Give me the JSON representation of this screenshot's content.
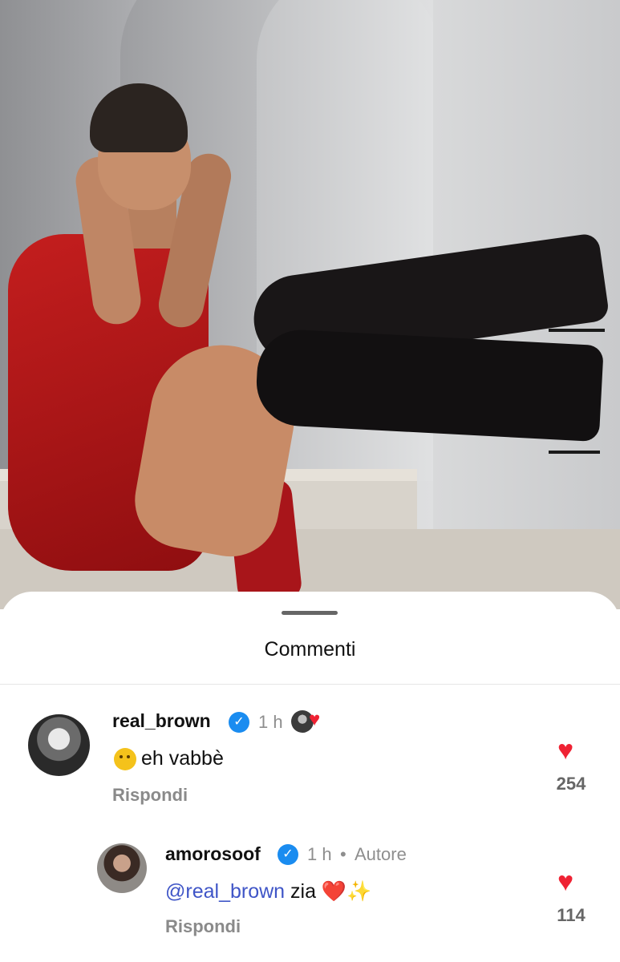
{
  "sheet": {
    "title": "Commenti"
  },
  "comments": [
    {
      "username": "real_brown",
      "verified": true,
      "time": "1 h",
      "liked_by_author": true,
      "emoji": "melting-face-emoji",
      "text": "eh vabbè",
      "reply_label": "Rispondi",
      "likes": "254"
    },
    {
      "username": "amorosoof",
      "verified": true,
      "time": "1 h",
      "separator": "•",
      "author_label": "Autore",
      "mention": "@real_brown",
      "text": " zia ❤️✨",
      "reply_label": "Rispondi",
      "likes": "114"
    }
  ],
  "icons": {
    "heart": "♥",
    "verified": "✓"
  },
  "colors": {
    "heart": "#ef2233",
    "verified": "#1a8cf0",
    "mention": "#3f55c7",
    "muted": "#8e8e8e"
  }
}
